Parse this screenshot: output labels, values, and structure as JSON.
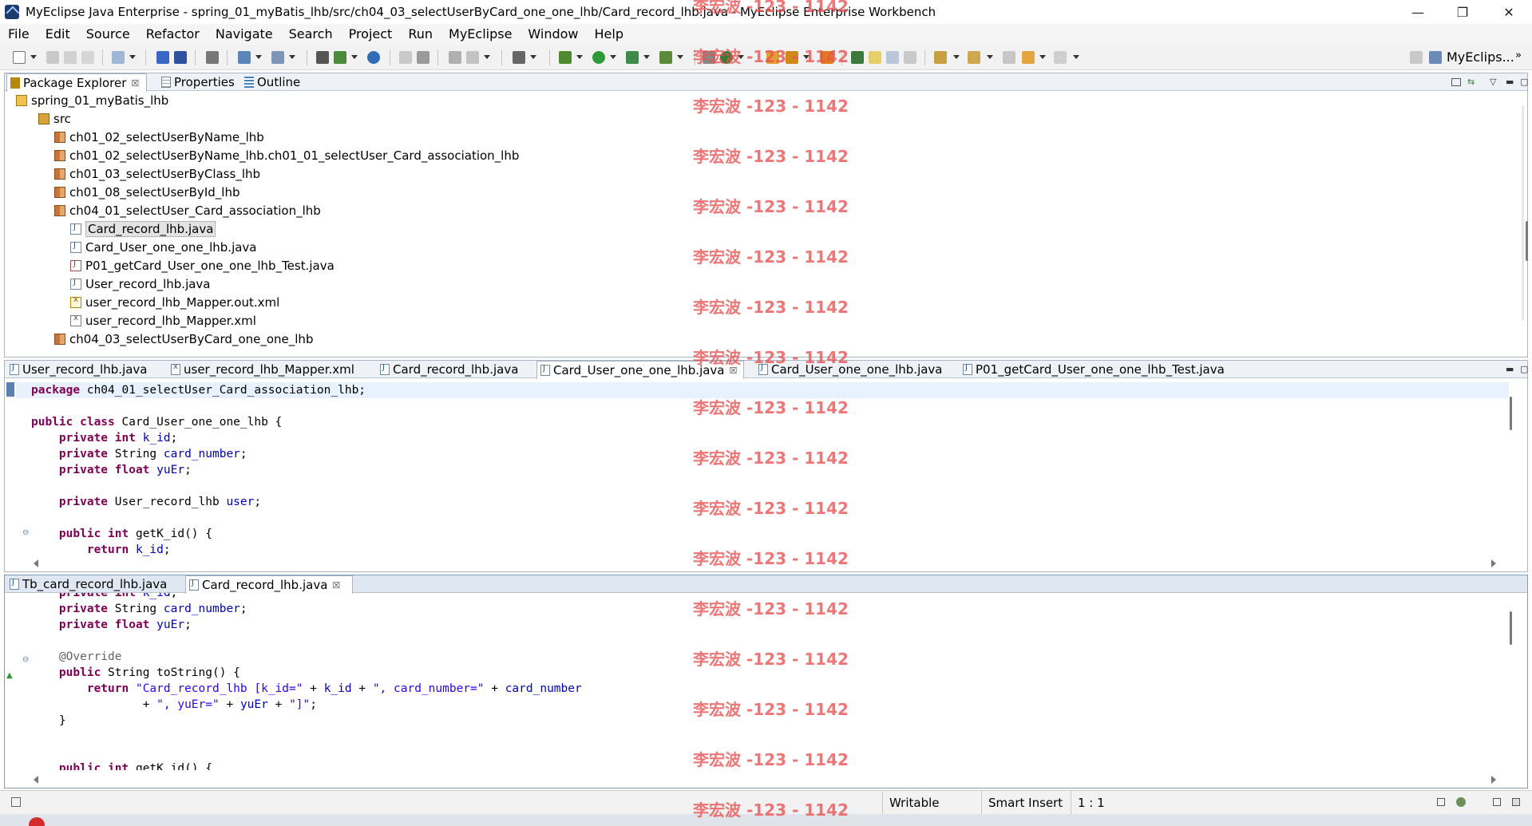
{
  "window": {
    "title": "MyEclipse Java Enterprise - spring_01_myBatis_lhb/src/ch04_03_selectUserByCard_one_one_lhb/Card_record_lhb.java - MyEclipse Enterprise Workbench",
    "minimize": "—",
    "maximize": "❐",
    "close": "✕"
  },
  "menu": [
    "File",
    "Edit",
    "Source",
    "Refactor",
    "Navigate",
    "Search",
    "Project",
    "Run",
    "MyEclipse",
    "Window",
    "Help"
  ],
  "toolbar": {
    "perspective_label": "MyEclips..."
  },
  "explorer": {
    "tabs": [
      {
        "label": "Package Explorer",
        "icon": "package-explorer-icon"
      },
      {
        "label": "Properties",
        "icon": "properties-icon"
      },
      {
        "label": "Outline",
        "icon": "outline-icon"
      }
    ],
    "tree": [
      {
        "label": "spring_01_myBatis_lhb",
        "icon": "project-icon",
        "depth": 0
      },
      {
        "label": "src",
        "icon": "source-folder-icon",
        "depth": 1
      },
      {
        "label": "ch01_02_selectUserByName_lhb",
        "icon": "package-icon",
        "depth": 2
      },
      {
        "label": "ch01_02_selectUserByName_lhb.ch01_01_selectUser_Card_association_lhb",
        "icon": "package-icon",
        "depth": 2
      },
      {
        "label": "ch01_03_selectUserByClass_lhb",
        "icon": "package-icon",
        "depth": 2
      },
      {
        "label": "ch01_08_selectUserById_lhb",
        "icon": "package-icon",
        "depth": 2
      },
      {
        "label": "ch04_01_selectUser_Card_association_lhb",
        "icon": "package-icon",
        "depth": 2
      },
      {
        "label": "Card_record_lhb.java",
        "icon": "java-file-icon",
        "depth": 3,
        "selected": true
      },
      {
        "label": "Card_User_one_one_lhb.java",
        "icon": "java-file-icon",
        "depth": 3
      },
      {
        "label": "P01_getCard_User_one_one_lhb_Test.java",
        "icon": "java-test-file-icon",
        "depth": 3
      },
      {
        "label": "User_record_lhb.java",
        "icon": "java-file-icon",
        "depth": 3
      },
      {
        "label": "user_record_lhb_Mapper.out.xml",
        "icon": "xml-output-file-icon",
        "depth": 3
      },
      {
        "label": "user_record_lhb_Mapper.xml",
        "icon": "xml-file-icon",
        "depth": 3
      },
      {
        "label": "ch04_03_selectUserByCard_one_one_lhb",
        "icon": "package-icon",
        "depth": 2
      }
    ]
  },
  "editor1": {
    "tabs": [
      {
        "label": "User_record_lhb.java",
        "icon": "java-file-icon"
      },
      {
        "label": "user_record_lhb_Mapper.xml",
        "icon": "xml-file-icon"
      },
      {
        "label": "Card_record_lhb.java",
        "icon": "java-file-icon"
      },
      {
        "label": "Card_User_one_one_lhb.java",
        "icon": "java-file-icon",
        "active": true,
        "close": "☒"
      },
      {
        "label": "Card_User_one_one_lhb.java",
        "icon": "java-file-icon"
      },
      {
        "label": "P01_getCard_User_one_one_lhb_Test.java",
        "icon": "java-file-icon"
      }
    ],
    "code": {
      "l1_kw": "package",
      "l1_rest": " ch04_01_selectUser_Card_association_lhb;",
      "l3_kw": "public class",
      "l3_rest": " Card_User_one_one_lhb {",
      "l4_kw": "private int",
      "l4_field": "k_id",
      "l5_kw": "private",
      "l5_type": " String ",
      "l5_field": "card_number",
      "l6_kw": "private float",
      "l6_field": "yuEr",
      "l8_kw": "private",
      "l8_type": " User_record_lhb ",
      "l8_field": "user",
      "l10_kw": "public int",
      "l10_rest": " getK_id() {",
      "l11_kw": "return",
      "l11_field": "k_id",
      "semi": ";"
    }
  },
  "editor2": {
    "tabs": [
      {
        "label": "Tb_card_record_lhb.java",
        "icon": "java-file-icon"
      },
      {
        "label": "Card_record_lhb.java",
        "icon": "java-file-icon",
        "active": true,
        "close": "☒"
      }
    ],
    "code": {
      "l0_kw": "private int",
      "l0_field": "k_id",
      "l1_kw": "private",
      "l1_type": " String ",
      "l1_field": "card_number",
      "l2_kw": "private float",
      "l2_field": "yuEr",
      "l4_ann": "@Override",
      "l5_kw": "public",
      "l5_rest": " String toString() {",
      "l6_kw": "return",
      "l6_str1": "\"Card_record_lhb [k_id=\"",
      "l6_plus1": " + ",
      "l6_f1": "k_id",
      "l6_str2": "\", card_number=\"",
      "l6_f2": "card_number",
      "l7_plus": "+ ",
      "l7_str1": "\", yuEr=\"",
      "l7_f": "yuEr",
      "l7_str2": "\"]\"",
      "l8": "}",
      "l10_kw": "public int",
      "l10_rest": " getK_id() {"
    }
  },
  "status": {
    "mode": "Writable",
    "insert": "Smart Insert",
    "position": "1 : 1"
  },
  "watermark": "李宏波 -123 - 1142",
  "colors": {
    "keyword": "#7f0055",
    "field": "#0000c0",
    "string": "#2a00ff",
    "watermark": "#eb5050"
  }
}
